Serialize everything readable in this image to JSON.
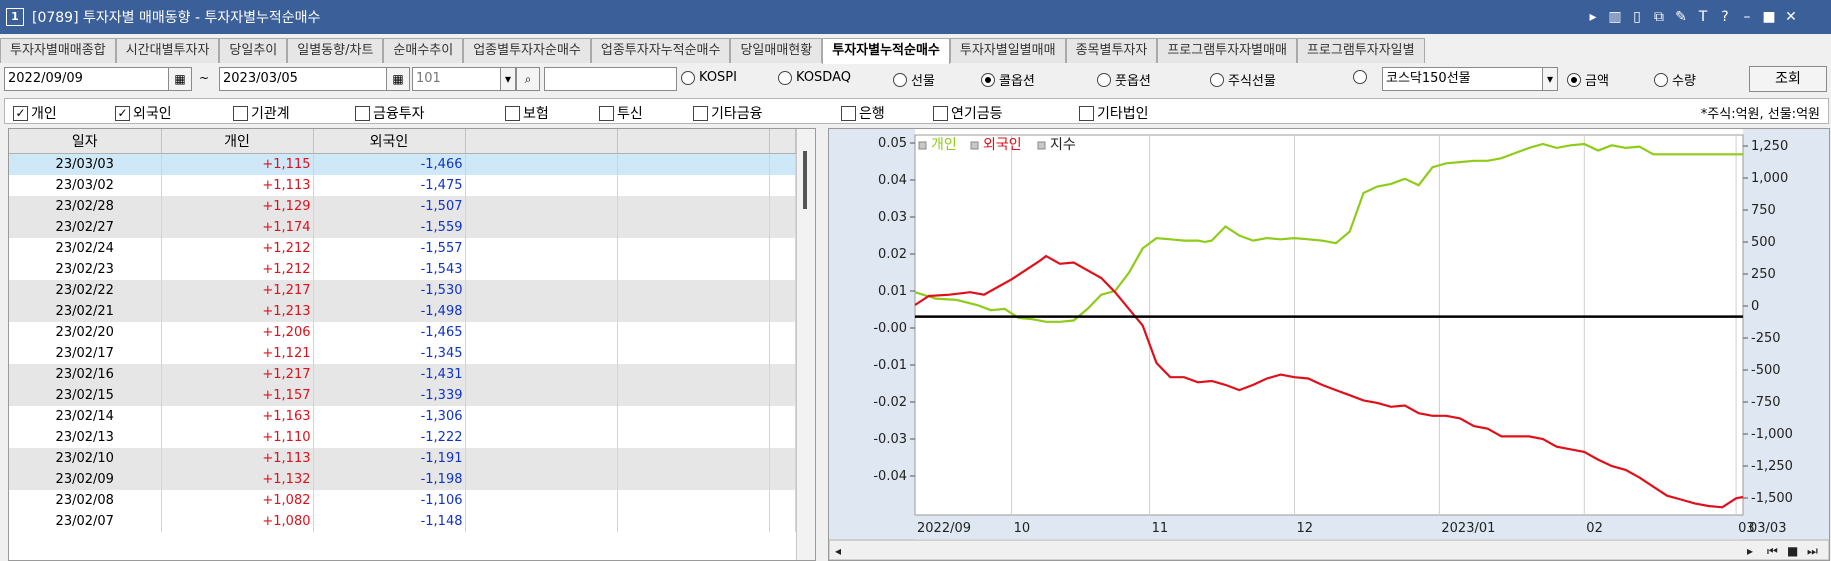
{
  "window": {
    "number": "1",
    "title": "[0789] 투자자별 매매동향 - 투자자별누적순매수"
  },
  "window_controls": [
    "▸",
    "▥",
    "▯",
    "⧉",
    "✎",
    "T",
    "?",
    "–",
    "■",
    "✕"
  ],
  "tabs": [
    "투자자별매매종합",
    "시간대별투자자",
    "당일추이",
    "일별동향/차트",
    "순매수추이",
    "업종별투자자순매수",
    "업종투자자누적순매수",
    "당일매매현황",
    "투자자별누적순매수",
    "투자자별일별매매",
    "종목별투자자",
    "프로그램투자자별매매",
    "프로그램투자자일별"
  ],
  "active_tab": 8,
  "controls": {
    "start_date": "2022/09/09",
    "separator": "~",
    "end_date": "2023/03/05",
    "code": "101",
    "search_value": "",
    "markets": [
      {
        "label": "KOSPI",
        "checked": false
      },
      {
        "label": "KOSDAQ",
        "checked": false
      },
      {
        "label": "선물",
        "checked": false
      },
      {
        "label": "콜옵션",
        "checked": true
      },
      {
        "label": "풋옵션",
        "checked": false
      },
      {
        "label": "주식선물",
        "checked": false
      },
      {
        "label": "",
        "checked": false
      }
    ],
    "futures_select": "코스닥150선물",
    "amount_label": "금액",
    "amount_checked": true,
    "quantity_label": "수량",
    "quantity_checked": false,
    "query_button": "조회"
  },
  "investors": [
    {
      "label": "개인",
      "checked": true
    },
    {
      "label": "외국인",
      "checked": true
    },
    {
      "label": "기관계",
      "checked": false
    },
    {
      "label": "금융투자",
      "checked": false
    },
    {
      "label": "보험",
      "checked": false
    },
    {
      "label": "투신",
      "checked": false
    },
    {
      "label": "기타금융",
      "checked": false
    },
    {
      "label": "은행",
      "checked": false
    },
    {
      "label": "연기금등",
      "checked": false
    },
    {
      "label": "기타법인",
      "checked": false
    }
  ],
  "unit_note": "*주식:억원, 선물:억원",
  "grid": {
    "headers": [
      "일자",
      "개인",
      "외국인",
      "",
      "",
      ""
    ],
    "rows": [
      [
        "23/03/03",
        "+1,115",
        "-1,466"
      ],
      [
        "23/03/02",
        "+1,113",
        "-1,475"
      ],
      [
        "23/02/28",
        "+1,129",
        "-1,507"
      ],
      [
        "23/02/27",
        "+1,174",
        "-1,559"
      ],
      [
        "23/02/24",
        "+1,212",
        "-1,557"
      ],
      [
        "23/02/23",
        "+1,212",
        "-1,543"
      ],
      [
        "23/02/22",
        "+1,217",
        "-1,530"
      ],
      [
        "23/02/21",
        "+1,213",
        "-1,498"
      ],
      [
        "23/02/20",
        "+1,206",
        "-1,465"
      ],
      [
        "23/02/17",
        "+1,121",
        "-1,345"
      ],
      [
        "23/02/16",
        "+1,217",
        "-1,431"
      ],
      [
        "23/02/15",
        "+1,157",
        "-1,339"
      ],
      [
        "23/02/14",
        "+1,163",
        "-1,306"
      ],
      [
        "23/02/13",
        "+1,110",
        "-1,222"
      ],
      [
        "23/02/10",
        "+1,113",
        "-1,191"
      ],
      [
        "23/02/09",
        "+1,132",
        "-1,198"
      ],
      [
        "23/02/08",
        "+1,082",
        "-1,106"
      ],
      [
        "23/02/07",
        "+1,080",
        "-1,148"
      ]
    ]
  },
  "chart_data": {
    "type": "line",
    "legend": [
      {
        "name": "개인",
        "color": "#8fcc1a"
      },
      {
        "name": "외국인",
        "color": "#e0101a"
      },
      {
        "name": "지수",
        "color": "#000000"
      }
    ],
    "left_ticks": [
      "0.05",
      "0.04",
      "0.03",
      "0.02",
      "0.01",
      "-0.00",
      "-0.01",
      "-0.02",
      "-0.03",
      "-0.04"
    ],
    "right_ticks": [
      "1,250",
      "1,000",
      "750",
      "500",
      "250",
      "0",
      "-250",
      "-500",
      "-750",
      "-1,000",
      "-1,250",
      "-1,500"
    ],
    "x_ticks": [
      "2022/09",
      "10",
      "11",
      "12",
      "2023/01",
      "02",
      "03"
    ],
    "x_right_label": "03/03",
    "xlim": [
      0,
      120
    ],
    "ylim": [
      -1650,
      1300
    ],
    "series": [
      {
        "name": "개인",
        "color": "#8fcc1a",
        "x": [
          0,
          3,
          6,
          9,
          11,
          13,
          15,
          17,
          19,
          21,
          23,
          25,
          27,
          29,
          31,
          33,
          35,
          37,
          39,
          41,
          42,
          43,
          45,
          47,
          49,
          51,
          53,
          55,
          57,
          59,
          61,
          63,
          65,
          67,
          69,
          71,
          73,
          75,
          77,
          79,
          81,
          83,
          85,
          87,
          89,
          91,
          93,
          95,
          97,
          99,
          101,
          103,
          105,
          107,
          109,
          111,
          113,
          115,
          117,
          119,
          120
        ],
        "y": [
          80,
          30,
          20,
          -20,
          -60,
          -50,
          -120,
          -130,
          -150,
          -150,
          -140,
          -50,
          60,
          90,
          230,
          420,
          500,
          490,
          480,
          480,
          470,
          480,
          590,
          520,
          480,
          500,
          490,
          500,
          490,
          480,
          460,
          550,
          850,
          900,
          920,
          960,
          910,
          1050,
          1080,
          1090,
          1100,
          1100,
          1120,
          1160,
          1200,
          1230,
          1200,
          1220,
          1230,
          1180,
          1220,
          1200,
          1210,
          1150,
          1150,
          1150,
          1150,
          1150,
          1150,
          1150,
          1150
        ]
      },
      {
        "name": "외국인",
        "color": "#e0101a",
        "x": [
          0,
          2,
          5,
          8,
          10,
          12,
          14,
          16,
          18,
          19,
          21,
          23,
          25,
          27,
          29,
          31,
          33,
          35,
          37,
          39,
          41,
          43,
          45,
          47,
          49,
          51,
          53,
          55,
          57,
          59,
          61,
          63,
          65,
          67,
          69,
          71,
          73,
          75,
          77,
          79,
          81,
          83,
          85,
          87,
          89,
          91,
          93,
          95,
          97,
          99,
          101,
          103,
          105,
          107,
          109,
          111,
          113,
          115,
          117,
          119,
          120
        ],
        "y": [
          -20,
          50,
          60,
          80,
          60,
          120,
          180,
          250,
          320,
          360,
          300,
          310,
          250,
          190,
          80,
          -50,
          -180,
          -470,
          -580,
          -580,
          -620,
          -610,
          -640,
          -680,
          -640,
          -590,
          -560,
          -580,
          -590,
          -640,
          -680,
          -720,
          -760,
          -780,
          -810,
          -800,
          -860,
          -880,
          -880,
          -900,
          -960,
          -980,
          -1040,
          -1040,
          -1040,
          -1060,
          -1120,
          -1140,
          -1160,
          -1220,
          -1270,
          -1300,
          -1360,
          -1430,
          -1500,
          -1530,
          -1560,
          -1580,
          -1590,
          -1520,
          -1510
        ]
      },
      {
        "name": "지수",
        "color": "#000000",
        "x": [
          0,
          120
        ],
        "y": [
          -110,
          -110
        ]
      }
    ]
  }
}
